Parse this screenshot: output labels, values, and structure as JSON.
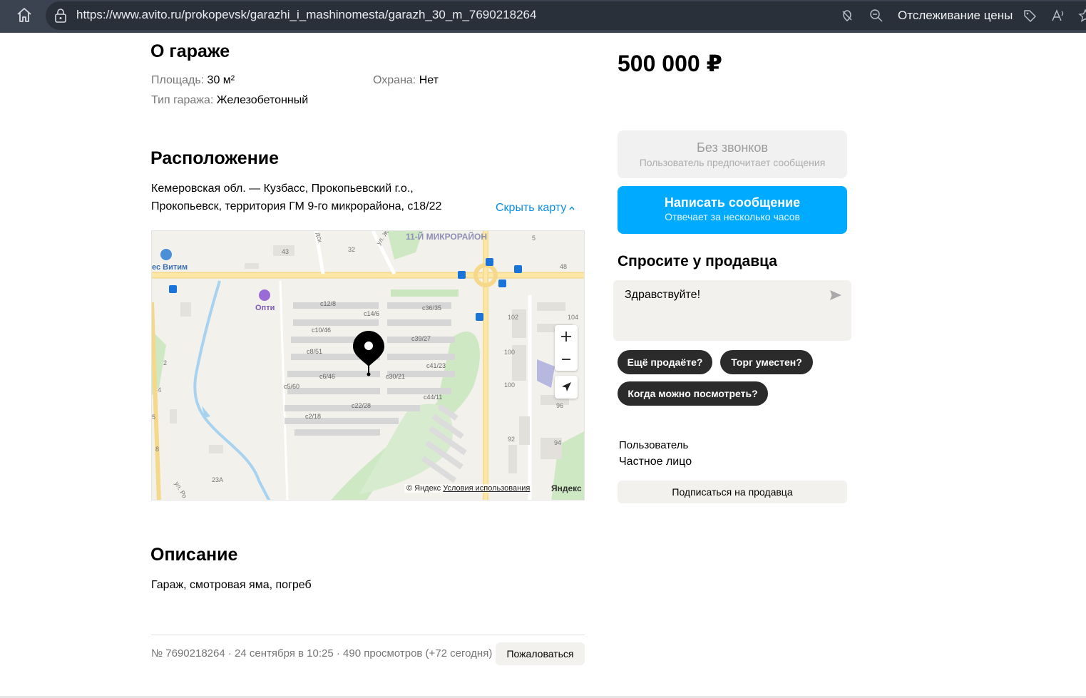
{
  "browser": {
    "url": "https://www.avito.ru/prokopevsk/garazhi_i_mashinomesta/garazh_30_m_7690218264",
    "price_tracking": "Отслеживание цены"
  },
  "about": {
    "title": "О гараже",
    "area_label": "Площадь:",
    "area_value": "30 м²",
    "security_label": "Охрана:",
    "security_value": "Нет",
    "type_label": "Тип гаража:",
    "type_value": "Железобетонный"
  },
  "location": {
    "title": "Расположение",
    "address_line1": "Кемеровская обл. — Кузбасс, Прокопьевский г.о.,",
    "address_line2": "Прокопьевск, территория ГМ 9-го микрорайона, с18/22",
    "hide_map": "Скрыть карту",
    "map": {
      "district": "11-Й МИКРОРАЙОН",
      "poi_vitim": "ес Витим",
      "poi_opti": "Опти",
      "copyright": "© Яндекс",
      "terms": "Условия использования",
      "brand": "Яндекс",
      "labels": [
        "c12/8",
        "c14/6",
        "c36/35",
        "c10/46",
        "c39/27",
        "c8/51",
        "c41/23",
        "c6/46",
        "c30/21",
        "c5/60",
        "c44/11",
        "c22/28",
        "c2/18",
        "43",
        "32",
        "5",
        "48",
        "102",
        "104",
        "100",
        "100",
        "96",
        "92",
        "94",
        "2",
        "4",
        "5",
        "8",
        "23А",
        "ул. Ро",
        "ул. Ж",
        "дск"
      ]
    }
  },
  "description": {
    "title": "Описание",
    "text": "Гараж, смотровая яма, погреб"
  },
  "meta": {
    "info": "№ 7690218264 · 24 сентября в 10:25 · 490 просмотров (+72 сегодня)",
    "report": "Пожаловаться"
  },
  "sidebar": {
    "price": "500 000 ₽",
    "no_calls_title": "Без звонков",
    "no_calls_sub": "Пользователь предпочитает сообщения",
    "write_title": "Написать сообщение",
    "write_sub": "Отвечает за несколько часов",
    "ask_title": "Спросите у продавца",
    "message_text": "Здравствуйте!",
    "chips": [
      "Ещё продаёте?",
      "Торг уместен?",
      "Когда можно посмотреть?"
    ],
    "seller_name": "Пользователь",
    "seller_type": "Частное лицо",
    "subscribe": "Подписаться на продавца"
  },
  "colors": {
    "accent": "#00aaff",
    "link": "#0a8ee8",
    "chip": "#2b2b2b",
    "browser_bar": "#3c4350"
  }
}
